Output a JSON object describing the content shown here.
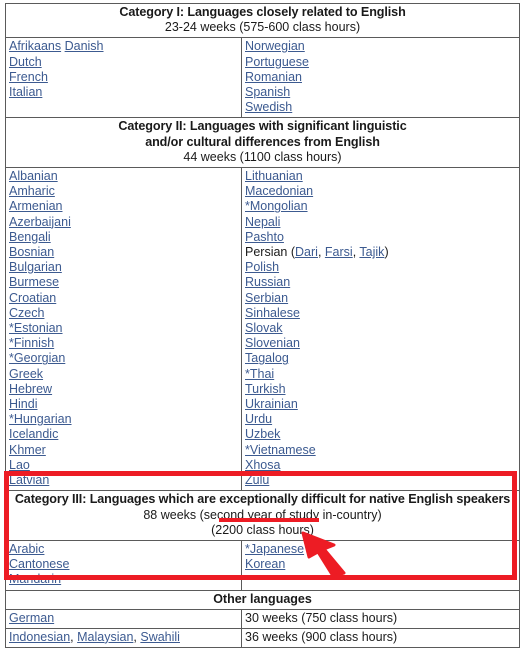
{
  "table": {
    "categories": [
      {
        "id": "category-1",
        "title": "Category I: Languages closely related to English",
        "subtitle": "23-24 weeks (575-600 class hours)",
        "left": [
          {
            "text": "Afrikaans",
            "link": true,
            "after": " "
          },
          {
            "text": "Danish",
            "link": true,
            "inline": true
          },
          {
            "text": "Dutch",
            "link": true
          },
          {
            "text": "French",
            "link": true
          },
          {
            "text": "Italian",
            "link": true
          }
        ],
        "right": [
          {
            "text": "Norwegian",
            "link": true
          },
          {
            "text": "Portuguese",
            "link": true
          },
          {
            "text": "Romanian",
            "link": true
          },
          {
            "text": "Spanish",
            "link": true
          },
          {
            "text": "Swedish",
            "link": true
          }
        ]
      },
      {
        "id": "category-2",
        "title": "Category II: Languages with significant linguistic and/or cultural differences from English",
        "title_line1": "Category II: Languages with significant linguistic",
        "title_line2": "and/or cultural differences from English",
        "subtitle": "44 weeks (1100 class hours)",
        "left": [
          {
            "text": "Albanian",
            "link": true
          },
          {
            "text": "Amharic",
            "link": true
          },
          {
            "text": "Armenian",
            "link": true
          },
          {
            "text": "Azerbaijani",
            "link": true
          },
          {
            "text": "Bengali",
            "link": true
          },
          {
            "text": "Bosnian",
            "link": true
          },
          {
            "text": "Bulgarian",
            "link": true
          },
          {
            "text": "Burmese",
            "link": true
          },
          {
            "text": "Croatian",
            "link": true
          },
          {
            "text": "Czech",
            "link": true
          },
          {
            "text": "*Estonian",
            "link": true
          },
          {
            "text": "*Finnish",
            "link": true
          },
          {
            "text": "*Georgian",
            "link": true
          },
          {
            "text": "Greek",
            "link": true
          },
          {
            "text": "Hebrew",
            "link": true
          },
          {
            "text": "Hindi",
            "link": true
          },
          {
            "text": "*Hungarian",
            "link": true
          },
          {
            "text": "Icelandic",
            "link": true
          },
          {
            "text": "Khmer",
            "link": true
          },
          {
            "text": "Lao",
            "link": true
          },
          {
            "text": "Latvian",
            "link": true
          }
        ],
        "right": [
          {
            "text": "Lithuanian",
            "link": true
          },
          {
            "text": "Macedonian",
            "link": true
          },
          {
            "text": "*Mongolian",
            "link": true
          },
          {
            "text": "Nepali",
            "link": true
          },
          {
            "text": "Pashto",
            "link": true
          },
          {
            "text": "Persian (Dari, Farsi, Tajik)",
            "composite": "persian"
          },
          {
            "text": "Polish",
            "link": true
          },
          {
            "text": "Russian",
            "link": true
          },
          {
            "text": "Serbian",
            "link": true
          },
          {
            "text": "Sinhalese",
            "link": true
          },
          {
            "text": "Slovak",
            "link": true
          },
          {
            "text": "Slovenian",
            "link": true
          },
          {
            "text": "Tagalog",
            "link": true
          },
          {
            "text": "*Thai",
            "link": true
          },
          {
            "text": "Turkish",
            "link": true
          },
          {
            "text": "Ukrainian",
            "link": true
          },
          {
            "text": "Urdu",
            "link": true
          },
          {
            "text": "Uzbek",
            "link": true
          },
          {
            "text": "*Vietnamese",
            "link": true
          },
          {
            "text": "Xhosa",
            "link": true
          },
          {
            "text": "Zulu",
            "link": true
          }
        ]
      },
      {
        "id": "category-3",
        "title": "Category III: Languages which are exceptionally difficult for native English speakers",
        "subtitle_line1": "88 weeks (second year of study in-country)",
        "subtitle_line2": "(2200 class hours)",
        "left": [
          {
            "text": "Arabic",
            "link": true
          },
          {
            "text": "Cantonese",
            "link": true
          },
          {
            "text": "Mandarin ",
            "link": true
          }
        ],
        "right": [
          {
            "text": "*Japanese",
            "link": true
          },
          {
            "text": "Korean",
            "link": true
          }
        ]
      }
    ],
    "persian": {
      "prefix": "Persian (",
      "items": [
        "Dari",
        "Farsi",
        "Tajik"
      ],
      "separator": ", ",
      "suffix": ")"
    },
    "other": {
      "heading": "Other languages",
      "rows": [
        {
          "languages": [
            {
              "text": "German",
              "link": true
            }
          ],
          "hours": "30 weeks (750 class hours)"
        },
        {
          "languages": [
            {
              "text": "Indonesian",
              "link": true
            },
            {
              "text": "Malaysian",
              "link": true
            },
            {
              "text": "Swahili",
              "link": true
            }
          ],
          "separator": ", ",
          "hours": "36 weeks (900 class hours)"
        }
      ]
    }
  },
  "annotations": {
    "highlight_color": "#ed1c24",
    "box_target": "category-3",
    "underline_target": "(2200 class hours)",
    "arrow_target": "*Japanese"
  },
  "colors": {
    "link": "#3c5a90",
    "text": "#1a1a1a",
    "border": "#5a5a5a",
    "accent": "#ed1c24",
    "background": "#ffffff"
  }
}
